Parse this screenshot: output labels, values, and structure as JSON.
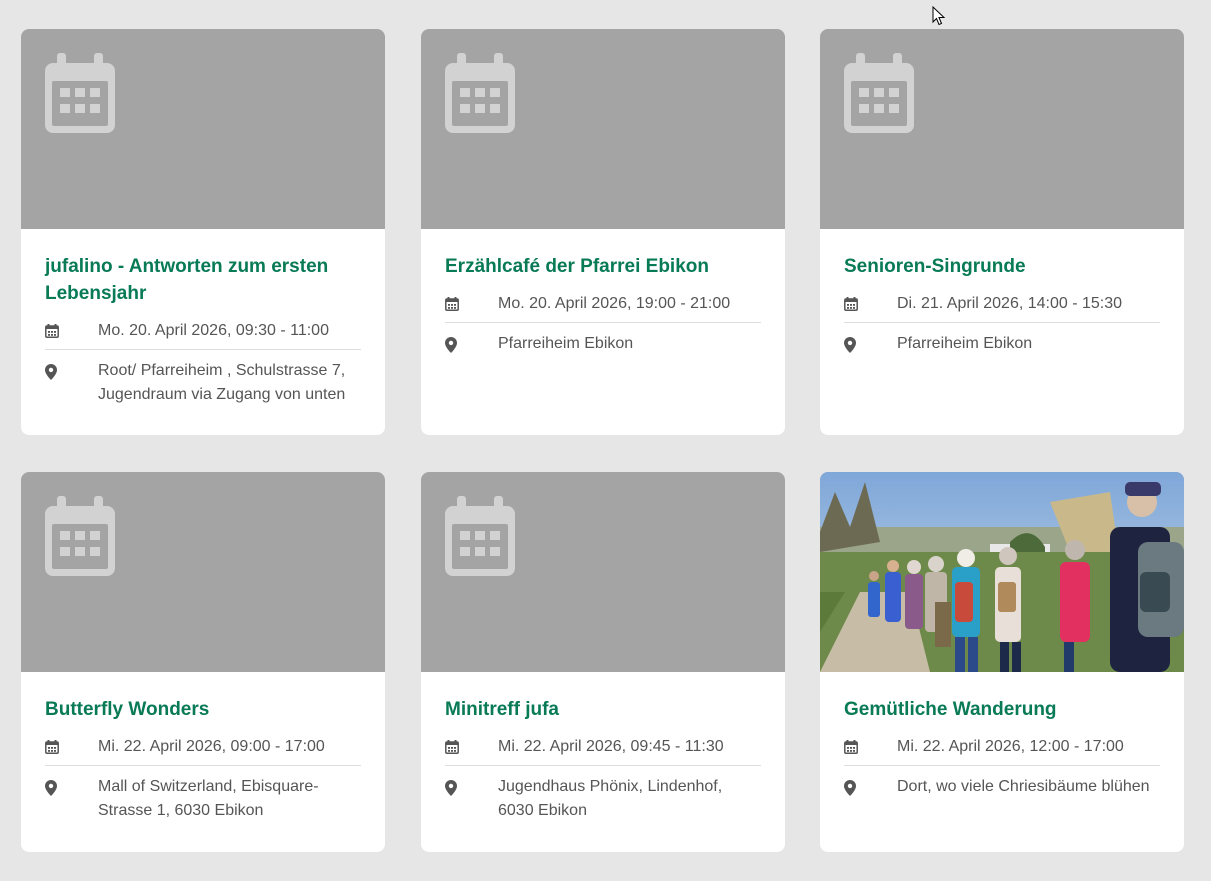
{
  "colors": {
    "page_background": "#e6e6e6",
    "title_green": "#087a55",
    "placeholder_gray": "#a4a4a4",
    "text_gray": "#555555"
  },
  "events": [
    {
      "title": "jufalino - Antworten zum ersten Lebensjahr",
      "date": "Mo. 20. April 2026, 09:30 - 11:00",
      "location": "Root/ Pfarreiheim , Schulstrasse 7, Jugendraum via Zugang von unten",
      "image": "calendar-placeholder"
    },
    {
      "title": "Erzählcafé der Pfarrei Ebikon",
      "date": "Mo. 20. April 2026, 19:00 - 21:00",
      "location": "Pfarreiheim Ebikon",
      "image": "calendar-placeholder"
    },
    {
      "title": "Senioren-Singrunde",
      "date": "Di. 21. April 2026, 14:00 - 15:30",
      "location": "Pfarreiheim Ebikon",
      "image": "calendar-placeholder"
    },
    {
      "title": "Butterfly Wonders",
      "date": "Mi. 22. April 2026, 09:00 - 17:00",
      "location": "Mall of Switzerland, Ebisquare-Strasse 1, 6030 Ebikon",
      "image": "calendar-placeholder"
    },
    {
      "title": "Minitreff jufa",
      "date": "Mi. 22. April 2026, 09:45 - 11:30",
      "location": "Jugendhaus Phönix, Lindenhof, 6030 Ebikon",
      "image": "calendar-placeholder"
    },
    {
      "title": "Gemütliche Wanderung",
      "date": "Mi. 22. April 2026, 12:00 - 17:00",
      "location": "Dort, wo viele Chriesibäume blühen",
      "image": "hiking-group-photo"
    }
  ]
}
